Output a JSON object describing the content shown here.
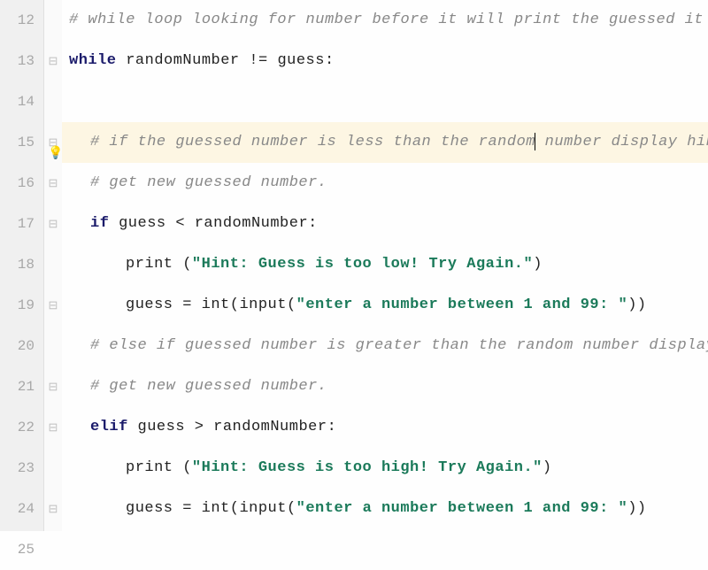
{
  "lines": [
    {
      "num": "12",
      "fold": "",
      "indent": 0,
      "highlighted": false,
      "bulb": false,
      "tokens": [
        {
          "cls": "comment",
          "text": "# while loop looking for number before it will print the guessed it message"
        }
      ]
    },
    {
      "num": "13",
      "fold": "⊟",
      "indent": 0,
      "highlighted": false,
      "bulb": false,
      "tokens": [
        {
          "cls": "keyword",
          "text": "while "
        },
        {
          "cls": "identifier",
          "text": "randomNumber "
        },
        {
          "cls": "operator",
          "text": "!= "
        },
        {
          "cls": "identifier",
          "text": "guess"
        },
        {
          "cls": "operator",
          "text": ":"
        }
      ]
    },
    {
      "num": "14",
      "fold": "",
      "indent": 0,
      "highlighted": false,
      "bulb": false,
      "tokens": []
    },
    {
      "num": "15",
      "fold": "⊟",
      "indent": 1,
      "highlighted": true,
      "bulb": true,
      "tokens": [
        {
          "cls": "comment",
          "text": "# if the guessed number is less than the random"
        },
        {
          "cls": "caret",
          "text": ""
        },
        {
          "cls": "comment",
          "text": " number display hint."
        }
      ]
    },
    {
      "num": "16",
      "fold": "⊟",
      "indent": 1,
      "highlighted": false,
      "bulb": false,
      "tokens": [
        {
          "cls": "comment",
          "text": "# get new guessed number."
        }
      ]
    },
    {
      "num": "17",
      "fold": "⊟",
      "indent": 1,
      "highlighted": false,
      "bulb": false,
      "tokens": [
        {
          "cls": "keyword",
          "text": "if "
        },
        {
          "cls": "identifier",
          "text": "guess "
        },
        {
          "cls": "operator",
          "text": "< "
        },
        {
          "cls": "identifier",
          "text": "randomNumber"
        },
        {
          "cls": "operator",
          "text": ":"
        }
      ]
    },
    {
      "num": "18",
      "fold": "",
      "indent": 2,
      "highlighted": false,
      "bulb": false,
      "tokens": [
        {
          "cls": "builtin",
          "text": "print "
        },
        {
          "cls": "paren",
          "text": "("
        },
        {
          "cls": "string",
          "text": "\"Hint: Guess is too low! Try Again.\""
        },
        {
          "cls": "paren",
          "text": ")"
        }
      ]
    },
    {
      "num": "19",
      "fold": "⊟",
      "indent": 2,
      "highlighted": false,
      "bulb": false,
      "tokens": [
        {
          "cls": "identifier",
          "text": "guess "
        },
        {
          "cls": "operator",
          "text": "= "
        },
        {
          "cls": "builtin",
          "text": "int"
        },
        {
          "cls": "paren",
          "text": "("
        },
        {
          "cls": "builtin",
          "text": "input"
        },
        {
          "cls": "paren",
          "text": "("
        },
        {
          "cls": "string",
          "text": "\"enter a number between 1 and 99: \""
        },
        {
          "cls": "paren",
          "text": "))"
        }
      ]
    },
    {
      "num": "20",
      "fold": "",
      "indent": 1,
      "highlighted": false,
      "bulb": false,
      "tokens": [
        {
          "cls": "comment",
          "text": "# else if guessed number is greater than the random number display hit"
        }
      ]
    },
    {
      "num": "21",
      "fold": "⊟",
      "indent": 1,
      "highlighted": false,
      "bulb": false,
      "tokens": [
        {
          "cls": "comment",
          "text": "# get new guessed number."
        }
      ]
    },
    {
      "num": "22",
      "fold": "⊟",
      "indent": 1,
      "highlighted": false,
      "bulb": false,
      "tokens": [
        {
          "cls": "keyword",
          "text": "elif "
        },
        {
          "cls": "identifier",
          "text": "guess "
        },
        {
          "cls": "operator",
          "text": "> "
        },
        {
          "cls": "identifier",
          "text": "randomNumber"
        },
        {
          "cls": "operator",
          "text": ":"
        }
      ]
    },
    {
      "num": "23",
      "fold": "",
      "indent": 2,
      "highlighted": false,
      "bulb": false,
      "tokens": [
        {
          "cls": "builtin",
          "text": "print "
        },
        {
          "cls": "paren",
          "text": "("
        },
        {
          "cls": "string",
          "text": "\"Hint: Guess is too high! Try Again.\""
        },
        {
          "cls": "paren",
          "text": ")"
        }
      ]
    },
    {
      "num": "24",
      "fold": "⊟",
      "indent": 2,
      "highlighted": false,
      "bulb": false,
      "tokens": [
        {
          "cls": "identifier",
          "text": "guess "
        },
        {
          "cls": "operator",
          "text": "= "
        },
        {
          "cls": "builtin",
          "text": "int"
        },
        {
          "cls": "paren",
          "text": "("
        },
        {
          "cls": "builtin",
          "text": "input"
        },
        {
          "cls": "paren",
          "text": "("
        },
        {
          "cls": "string",
          "text": "\"enter a number between 1 and 99: \""
        },
        {
          "cls": "paren",
          "text": "))"
        }
      ]
    },
    {
      "num": "25",
      "fold": "",
      "indent": 0,
      "highlighted": false,
      "bulb": false,
      "tokens": []
    }
  ]
}
